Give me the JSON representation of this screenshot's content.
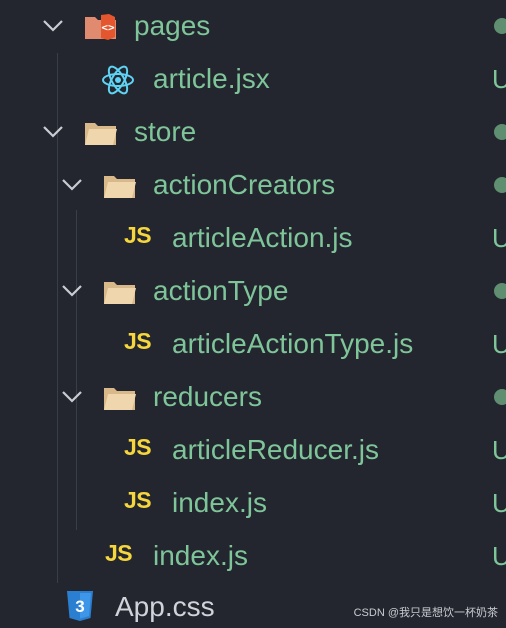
{
  "tree": {
    "items": [
      {
        "label": "pages",
        "kind": "folder-pages",
        "status": "dot"
      },
      {
        "label": "article.jsx",
        "kind": "react",
        "status": "U"
      },
      {
        "label": "store",
        "kind": "folder",
        "status": "dot"
      },
      {
        "label": "actionCreators",
        "kind": "folder",
        "status": "dot"
      },
      {
        "label": "articleAction.js",
        "kind": "js",
        "status": "U"
      },
      {
        "label": "actionType",
        "kind": "folder",
        "status": "dot"
      },
      {
        "label": "articleActionType.js",
        "kind": "js",
        "status": "U"
      },
      {
        "label": "reducers",
        "kind": "folder",
        "status": "dot"
      },
      {
        "label": "articleReducer.js",
        "kind": "js",
        "status": "U"
      },
      {
        "label": "index.js",
        "kind": "js",
        "status": "U"
      },
      {
        "label": "index.js",
        "kind": "js",
        "status": "U"
      },
      {
        "label": "App.css",
        "kind": "css",
        "status": ""
      }
    ],
    "js_badge": "JS",
    "css_badge": "3"
  },
  "watermark": "CSDN @我只是想饮一杯奶茶",
  "colors": {
    "background": "#23262e",
    "git_text": "#7fc59a",
    "plain_text": "#d0d3da",
    "js_yellow": "#f5d63d",
    "folder": "#d9b98a",
    "react": "#5ed3f3",
    "css_blue": "#2a7fd0",
    "html_orange": "#e4572e"
  }
}
